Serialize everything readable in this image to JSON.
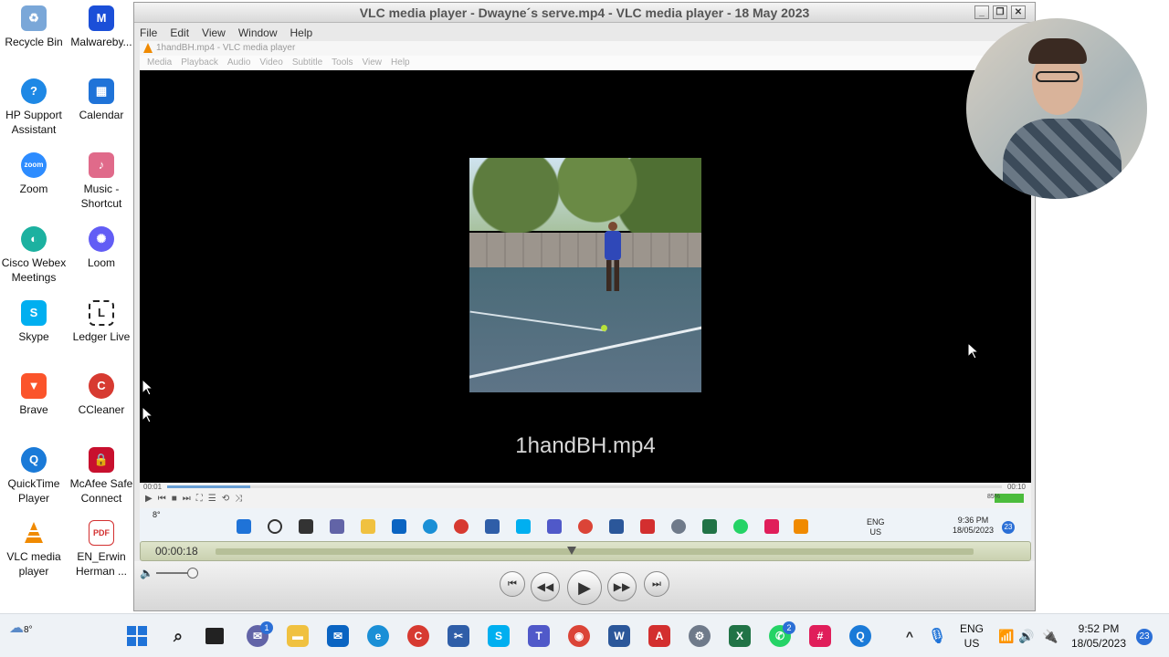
{
  "desktop": {
    "icons": [
      {
        "label": "Recycle Bin",
        "color": "#7aa7d8"
      },
      {
        "label": "Malwareby...",
        "color": "#1b4fd8"
      },
      {
        "label": "HP Support Assistant",
        "color": "#1e88e5"
      },
      {
        "label": "Calendar",
        "color": "#1f73d8"
      },
      {
        "label": "Zoom",
        "color": "#2d8cff"
      },
      {
        "label": "Music - Shortcut",
        "color": "#e06a8a"
      },
      {
        "label": "Cisco Webex Meetings",
        "color": "#1cb1a0"
      },
      {
        "label": "Loom",
        "color": "#625df5"
      },
      {
        "label": "Skype",
        "color": "#00aff0"
      },
      {
        "label": "Ledger Live",
        "color": "#222222"
      },
      {
        "label": "Brave",
        "color": "#fb542b"
      },
      {
        "label": "CCleaner",
        "color": "#d73a31"
      },
      {
        "label": "QuickTime Player",
        "color": "#1a7ad8"
      },
      {
        "label": "McAfee Safe Connect",
        "color": "#c8102e"
      },
      {
        "label": "VLC media player",
        "color": "#f08a00"
      },
      {
        "label": "EN_Erwin Herman ...",
        "color": "#d32f2f"
      }
    ]
  },
  "vlc": {
    "title": "VLC media player - Dwayne´s serve.mp4 - VLC media player - 18 May 2023",
    "menu": [
      "File",
      "Edit",
      "View",
      "Window",
      "Help"
    ],
    "window_buttons": [
      "_",
      "❐",
      "✕"
    ]
  },
  "inner": {
    "title": "1handBH.mp4 - VLC media player",
    "menu": [
      "Media",
      "Playback",
      "Audio",
      "Video",
      "Subtitle",
      "Tools",
      "View",
      "Help"
    ],
    "filename": "1handBH.mp4",
    "time_elapsed": "00:01",
    "time_total": "00:10",
    "progress": 0.1,
    "volume": "85%",
    "weather_temp": "8°",
    "lang": "ENG",
    "region": "US",
    "clock_time": "9:36 PM",
    "clock_date": "18/05/2023",
    "badge": "23"
  },
  "quicktime": {
    "current_time": "00:00:18",
    "position": 0.47
  },
  "taskbar": {
    "weather_temp": "8°",
    "lang": "ENG",
    "region": "US",
    "time": "9:52 PM",
    "date": "18/05/2023",
    "notification_count": "23",
    "teams_badge": "1",
    "whatsapp_badge": "2"
  }
}
